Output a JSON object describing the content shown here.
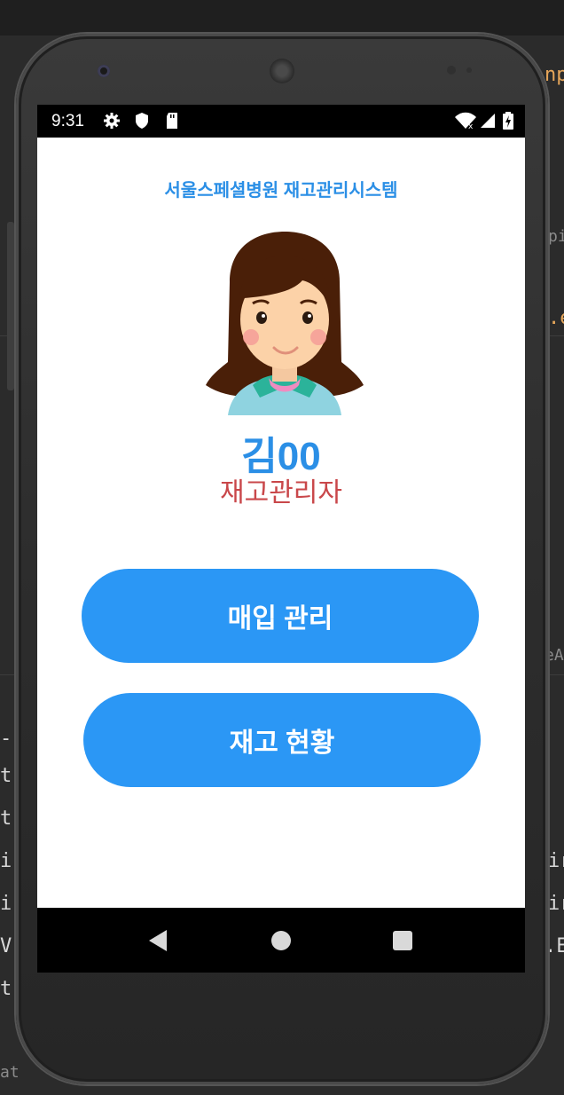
{
  "ide": {
    "right_snippets": [
      "np",
      "pi",
      ".e",
      "eA",
      "ir",
      "ir",
      ".E"
    ],
    "left_snippets": [
      "-",
      "t",
      "t",
      "i",
      "i",
      "V",
      "t"
    ],
    "bottom_left": "at"
  },
  "status_bar": {
    "time": "9:31",
    "icons": [
      "settings-gear-icon",
      "shield-icon",
      "sd-card-icon",
      "wifi-icon",
      "signal-icon",
      "battery-charging-icon"
    ]
  },
  "app": {
    "title": "서울스페셜병원 재고관리시스템",
    "user": {
      "name": "김00",
      "role": "재고관리자",
      "avatar": "girl-avatar-icon"
    },
    "buttons": {
      "purchase": "매입 관리",
      "inventory": "재고 현황"
    }
  },
  "colors": {
    "accent": "#2b97f5",
    "title_blue": "#2b8fe6",
    "role_red": "#c9474a",
    "bars": "#000000"
  },
  "nav_bar": {
    "icons": [
      "back-triangle-icon",
      "home-circle-icon",
      "recents-square-icon"
    ]
  }
}
